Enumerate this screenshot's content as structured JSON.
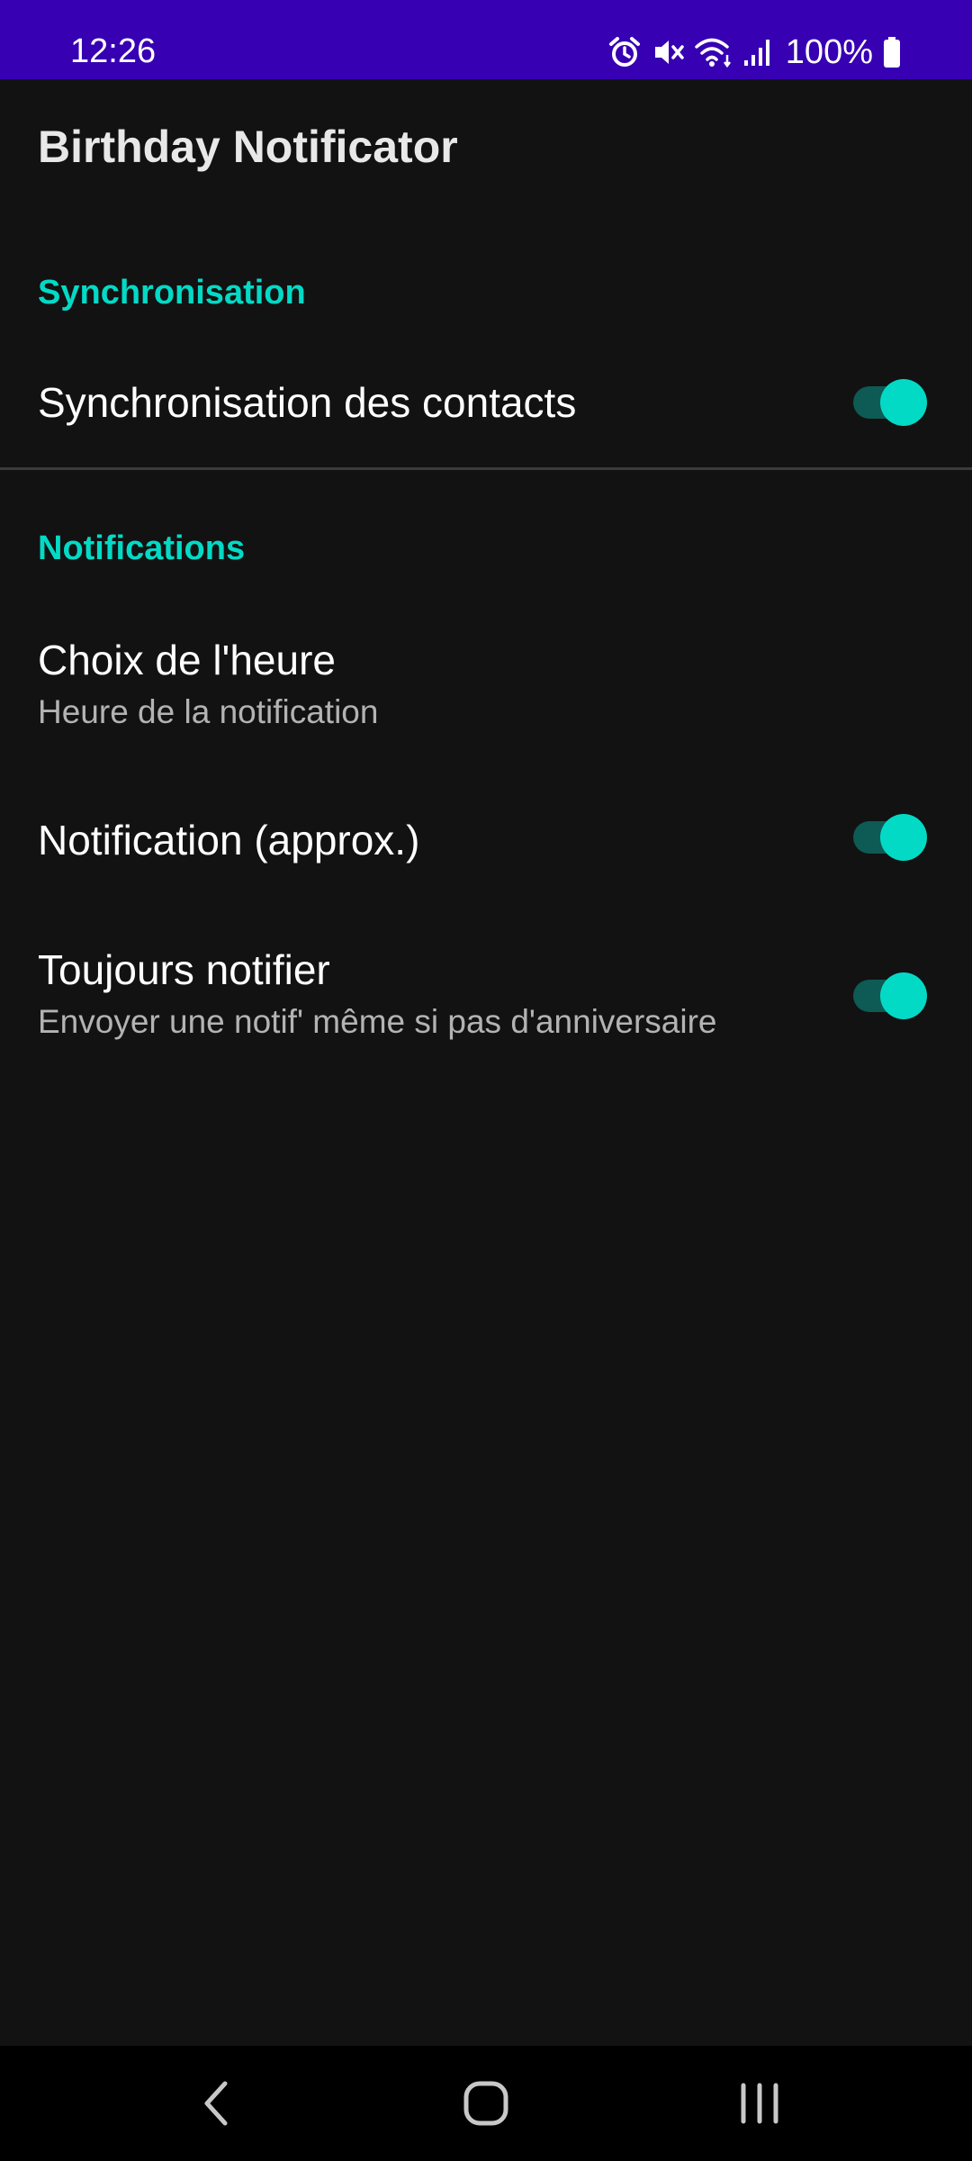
{
  "status_bar": {
    "time": "12:26",
    "battery": "100%",
    "icons": [
      "alarm-icon",
      "mute-icon",
      "wifi-icon",
      "signal-icon",
      "battery-icon"
    ],
    "background": "#3700b3"
  },
  "app_bar": {
    "title": "Birthday Notificator"
  },
  "categories": [
    {
      "title": "Synchronisation",
      "prefs": [
        {
          "title": "Synchronisation des contacts",
          "summary": "",
          "switch_on": true
        }
      ]
    },
    {
      "title": "Notifications",
      "prefs": [
        {
          "title": "Choix de l'heure",
          "summary": "Heure de la notification"
        },
        {
          "title": "Notification (approx.)",
          "summary": "",
          "switch_on": true
        },
        {
          "title": "Toujours notifier",
          "summary": "Envoyer une notif' même si pas d'anniversaire",
          "switch_on": true
        }
      ]
    }
  ],
  "nav_bar": {
    "buttons": [
      "back-icon",
      "home-icon",
      "recents-icon"
    ]
  },
  "colors": {
    "accent": "#03dac6",
    "background": "#121212",
    "switch_track": "#0e5a54"
  }
}
